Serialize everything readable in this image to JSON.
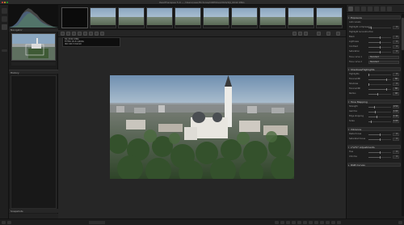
{
  "window": {
    "title": "RawTherapee 5.0 — /Users/user/Pictures/ODESSA/2016/DJI_0042.DNG"
  },
  "colors": {
    "background": "#1a1a1a",
    "panel": "#1e1e1e",
    "accent_active": "#4a4a4a",
    "sky_blue": "#8aa6c0"
  },
  "left_panel": {
    "navigator_title": "Navigator",
    "history_title": "History",
    "snapshots_title": "Snapshots"
  },
  "filmstrip": {
    "count_visible": 10
  },
  "tooltip": {
    "lines": [
      "DJI_0042.DNG",
      "FC330 f/2.8 1/400s",
      "ISO 100  3.61mm"
    ]
  },
  "right_panel": {
    "sections": [
      {
        "title": "Exposure"
      },
      {
        "title": "Shadows/Highlights"
      },
      {
        "title": "Tone Mapping"
      },
      {
        "title": "Vibrance"
      },
      {
        "title": "L*a*b* Adjustments"
      },
      {
        "title": "RGB Curves"
      }
    ],
    "rows": [
      {
        "label": "Auto Levels",
        "value": ""
      },
      {
        "label": "Highlight compression",
        "value": "0"
      },
      {
        "label": "Highlight reconstruction",
        "value": ""
      },
      {
        "label": "Black",
        "value": "0"
      },
      {
        "label": "Lightness",
        "value": "0"
      },
      {
        "label": "Contrast",
        "value": "0"
      },
      {
        "label": "Saturation",
        "value": "0"
      },
      {
        "label": "Tone curve 1",
        "value": "Standard"
      },
      {
        "label": "Tone curve 2",
        "value": "Standard"
      },
      {
        "label": "Highlights",
        "value": "0"
      },
      {
        "label": "Tonal width",
        "value": "80"
      },
      {
        "label": "Shadows",
        "value": "0"
      },
      {
        "label": "Tonal width",
        "value": "80"
      },
      {
        "label": "Radius",
        "value": "40"
      },
      {
        "label": "Strength",
        "value": "0.50"
      },
      {
        "label": "Gamma",
        "value": "1.00"
      },
      {
        "label": "Edge stopping",
        "value": "1.40"
      },
      {
        "label": "Scale",
        "value": "1.00"
      },
      {
        "label": "Pastel tones",
        "value": "0"
      },
      {
        "label": "Saturated tones",
        "value": "0"
      },
      {
        "label": "Hue",
        "value": "0"
      },
      {
        "label": "Chroma",
        "value": "0"
      }
    ]
  }
}
